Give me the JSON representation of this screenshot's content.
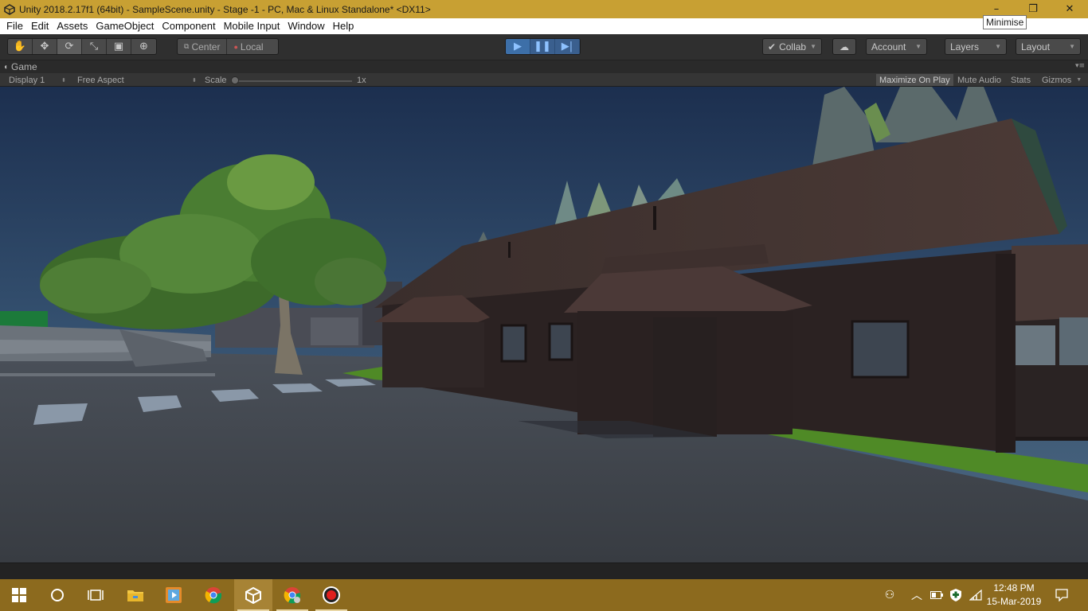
{
  "window": {
    "title": "Unity 2018.2.17f1 (64bit) - SampleScene.unity - Stage -1 - PC, Mac & Linux Standalone* <DX11>",
    "controls": [
      {
        "name": "minimise",
        "glyph": "–"
      },
      {
        "name": "restore",
        "glyph": "❐"
      },
      {
        "name": "close",
        "glyph": "✕"
      }
    ],
    "tooltip": "Minimise"
  },
  "menu": [
    "File",
    "Edit",
    "Assets",
    "GameObject",
    "Component",
    "Mobile Input",
    "Window",
    "Help"
  ],
  "toolbar": {
    "tools": [
      {
        "name": "hand-tool-icon",
        "glyph": "✋"
      },
      {
        "name": "move-tool-icon",
        "glyph": "✥"
      },
      {
        "name": "rotate-tool-icon",
        "glyph": "⟳"
      },
      {
        "name": "scale-tool-icon",
        "glyph": "⤡"
      },
      {
        "name": "rect-tool-icon",
        "glyph": "▣"
      },
      {
        "name": "transform-tool-icon",
        "glyph": "⊕"
      }
    ],
    "pivot_center": "Center",
    "pivot_local": "Local",
    "collab": "Collab",
    "account": "Account",
    "layers": "Layers",
    "layout": "Layout"
  },
  "game": {
    "tab_label": "Game",
    "display": "Display 1",
    "aspect": "Free Aspect",
    "scale_label": "Scale",
    "scale_value": "1x",
    "maximize_on_play": "Maximize On Play",
    "mute_audio": "Mute Audio",
    "stats": "Stats",
    "gizmos": "Gizmos"
  },
  "taskbar": {
    "apps": [
      "start",
      "cortana",
      "task-view",
      "file-explorer",
      "media",
      "chrome",
      "unity",
      "chrome-2",
      "recorder"
    ],
    "time": "12:48 PM",
    "date": "15-Mar-2019"
  },
  "colors": {
    "title_bar": "#c8a033",
    "taskbar": "#8c6a1e",
    "play_blue": "#3d6fa8"
  }
}
